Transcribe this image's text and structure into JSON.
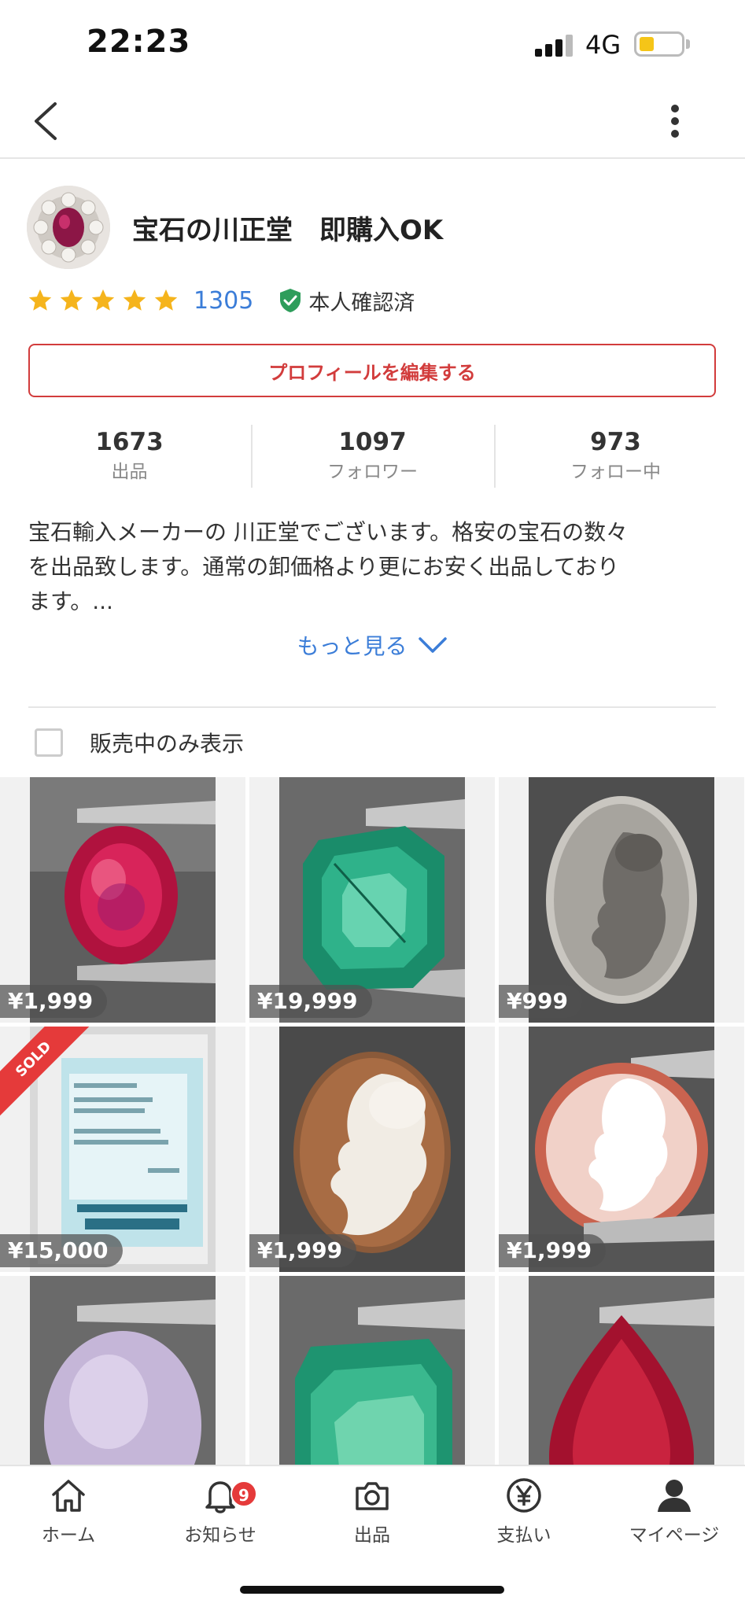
{
  "status_bar": {
    "time": "22:23",
    "network": "4G",
    "battery_fraction": 0.3
  },
  "profile": {
    "shop_name": "宝石の川正堂　即購入OK",
    "rating_stars": 5,
    "review_count": "1305",
    "verified_label": "本人確認済",
    "edit_button": "プロフィールを編集する",
    "stats": [
      {
        "value": "1673",
        "label": "出品"
      },
      {
        "value": "1097",
        "label": "フォロワー"
      },
      {
        "value": "973",
        "label": "フォロー中"
      }
    ],
    "bio_lines": [
      "宝石輸入メーカーの 川正堂でございます。格安の宝石の数々",
      "を出品致します。通常の卸価格より更にお安く出品しており",
      "ます。..."
    ],
    "more_link": "もっと見る"
  },
  "filter": {
    "label": "販売中のみ表示",
    "checked": false
  },
  "items": [
    {
      "price": "¥1,999",
      "image": "ruby-oval-icon",
      "sold": false
    },
    {
      "price": "¥19,999",
      "image": "emerald-square-icon",
      "sold": false
    },
    {
      "price": "¥999",
      "image": "cameo-grey-icon",
      "sold": false
    },
    {
      "price": "¥15,000",
      "image": "certificate-bag-icon",
      "sold": true,
      "sold_label": "SOLD"
    },
    {
      "price": "¥1,999",
      "image": "shell-cameo-icon",
      "sold": false
    },
    {
      "price": "¥1,999",
      "image": "pink-cameo-icon",
      "sold": false
    },
    {
      "price": "",
      "image": "lavender-jade-icon",
      "sold": false
    },
    {
      "price": "",
      "image": "emerald-square-icon",
      "sold": false
    },
    {
      "price": "",
      "image": "ruby-pear-icon",
      "sold": false
    }
  ],
  "tabs": [
    {
      "label": "ホーム",
      "icon": "home-icon"
    },
    {
      "label": "お知らせ",
      "icon": "bell-icon",
      "badge": "9"
    },
    {
      "label": "出品",
      "icon": "camera-icon"
    },
    {
      "label": "支払い",
      "icon": "yen-icon"
    },
    {
      "label": "マイページ",
      "icon": "person-icon"
    }
  ],
  "colors": {
    "accent_red": "#d23c3c",
    "link_blue": "#3b7dd8",
    "star": "#f5b41c",
    "verified_green": "#2e9d5b"
  }
}
